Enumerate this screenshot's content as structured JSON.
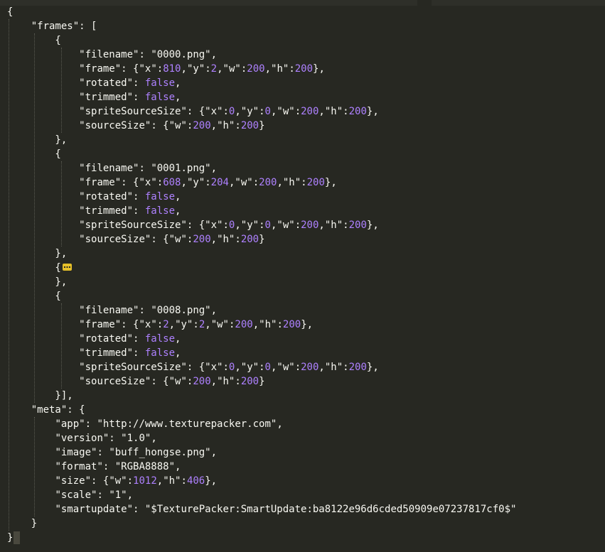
{
  "editor": {
    "lines": [
      [
        {
          "t": "p",
          "v": "{"
        }
      ],
      [
        {
          "t": "p",
          "v": "    "
        },
        {
          "t": "k",
          "v": "\"frames\""
        },
        {
          "t": "p",
          "v": ": ["
        }
      ],
      [
        {
          "t": "p",
          "v": "        {"
        }
      ],
      [
        {
          "t": "p",
          "v": "            "
        },
        {
          "t": "k",
          "v": "\"filename\""
        },
        {
          "t": "p",
          "v": ": "
        },
        {
          "t": "s",
          "v": "\"0000.png\""
        },
        {
          "t": "p",
          "v": ","
        }
      ],
      [
        {
          "t": "p",
          "v": "            "
        },
        {
          "t": "k",
          "v": "\"frame\""
        },
        {
          "t": "p",
          "v": ": {"
        },
        {
          "t": "k",
          "v": "\"x\""
        },
        {
          "t": "p",
          "v": ":"
        },
        {
          "t": "n",
          "v": "810"
        },
        {
          "t": "p",
          "v": ","
        },
        {
          "t": "k",
          "v": "\"y\""
        },
        {
          "t": "p",
          "v": ":"
        },
        {
          "t": "n",
          "v": "2"
        },
        {
          "t": "p",
          "v": ","
        },
        {
          "t": "k",
          "v": "\"w\""
        },
        {
          "t": "p",
          "v": ":"
        },
        {
          "t": "n",
          "v": "200"
        },
        {
          "t": "p",
          "v": ","
        },
        {
          "t": "k",
          "v": "\"h\""
        },
        {
          "t": "p",
          "v": ":"
        },
        {
          "t": "n",
          "v": "200"
        },
        {
          "t": "p",
          "v": "},"
        }
      ],
      [
        {
          "t": "p",
          "v": "            "
        },
        {
          "t": "k",
          "v": "\"rotated\""
        },
        {
          "t": "p",
          "v": ": "
        },
        {
          "t": "b",
          "v": "false"
        },
        {
          "t": "p",
          "v": ","
        }
      ],
      [
        {
          "t": "p",
          "v": "            "
        },
        {
          "t": "k",
          "v": "\"trimmed\""
        },
        {
          "t": "p",
          "v": ": "
        },
        {
          "t": "b",
          "v": "false"
        },
        {
          "t": "p",
          "v": ","
        }
      ],
      [
        {
          "t": "p",
          "v": "            "
        },
        {
          "t": "k",
          "v": "\"spriteSourceSize\""
        },
        {
          "t": "p",
          "v": ": {"
        },
        {
          "t": "k",
          "v": "\"x\""
        },
        {
          "t": "p",
          "v": ":"
        },
        {
          "t": "n",
          "v": "0"
        },
        {
          "t": "p",
          "v": ","
        },
        {
          "t": "k",
          "v": "\"y\""
        },
        {
          "t": "p",
          "v": ":"
        },
        {
          "t": "n",
          "v": "0"
        },
        {
          "t": "p",
          "v": ","
        },
        {
          "t": "k",
          "v": "\"w\""
        },
        {
          "t": "p",
          "v": ":"
        },
        {
          "t": "n",
          "v": "200"
        },
        {
          "t": "p",
          "v": ","
        },
        {
          "t": "k",
          "v": "\"h\""
        },
        {
          "t": "p",
          "v": ":"
        },
        {
          "t": "n",
          "v": "200"
        },
        {
          "t": "p",
          "v": "},"
        }
      ],
      [
        {
          "t": "p",
          "v": "            "
        },
        {
          "t": "k",
          "v": "\"sourceSize\""
        },
        {
          "t": "p",
          "v": ": {"
        },
        {
          "t": "k",
          "v": "\"w\""
        },
        {
          "t": "p",
          "v": ":"
        },
        {
          "t": "n",
          "v": "200"
        },
        {
          "t": "p",
          "v": ","
        },
        {
          "t": "k",
          "v": "\"h\""
        },
        {
          "t": "p",
          "v": ":"
        },
        {
          "t": "n",
          "v": "200"
        },
        {
          "t": "p",
          "v": "}"
        }
      ],
      [
        {
          "t": "p",
          "v": "        },"
        }
      ],
      [
        {
          "t": "p",
          "v": "        {"
        }
      ],
      [
        {
          "t": "p",
          "v": "            "
        },
        {
          "t": "k",
          "v": "\"filename\""
        },
        {
          "t": "p",
          "v": ": "
        },
        {
          "t": "s",
          "v": "\"0001.png\""
        },
        {
          "t": "p",
          "v": ","
        }
      ],
      [
        {
          "t": "p",
          "v": "            "
        },
        {
          "t": "k",
          "v": "\"frame\""
        },
        {
          "t": "p",
          "v": ": {"
        },
        {
          "t": "k",
          "v": "\"x\""
        },
        {
          "t": "p",
          "v": ":"
        },
        {
          "t": "n",
          "v": "608"
        },
        {
          "t": "p",
          "v": ","
        },
        {
          "t": "k",
          "v": "\"y\""
        },
        {
          "t": "p",
          "v": ":"
        },
        {
          "t": "n",
          "v": "204"
        },
        {
          "t": "p",
          "v": ","
        },
        {
          "t": "k",
          "v": "\"w\""
        },
        {
          "t": "p",
          "v": ":"
        },
        {
          "t": "n",
          "v": "200"
        },
        {
          "t": "p",
          "v": ","
        },
        {
          "t": "k",
          "v": "\"h\""
        },
        {
          "t": "p",
          "v": ":"
        },
        {
          "t": "n",
          "v": "200"
        },
        {
          "t": "p",
          "v": "},"
        }
      ],
      [
        {
          "t": "p",
          "v": "            "
        },
        {
          "t": "k",
          "v": "\"rotated\""
        },
        {
          "t": "p",
          "v": ": "
        },
        {
          "t": "b",
          "v": "false"
        },
        {
          "t": "p",
          "v": ","
        }
      ],
      [
        {
          "t": "p",
          "v": "            "
        },
        {
          "t": "k",
          "v": "\"trimmed\""
        },
        {
          "t": "p",
          "v": ": "
        },
        {
          "t": "b",
          "v": "false"
        },
        {
          "t": "p",
          "v": ","
        }
      ],
      [
        {
          "t": "p",
          "v": "            "
        },
        {
          "t": "k",
          "v": "\"spriteSourceSize\""
        },
        {
          "t": "p",
          "v": ": {"
        },
        {
          "t": "k",
          "v": "\"x\""
        },
        {
          "t": "p",
          "v": ":"
        },
        {
          "t": "n",
          "v": "0"
        },
        {
          "t": "p",
          "v": ","
        },
        {
          "t": "k",
          "v": "\"y\""
        },
        {
          "t": "p",
          "v": ":"
        },
        {
          "t": "n",
          "v": "0"
        },
        {
          "t": "p",
          "v": ","
        },
        {
          "t": "k",
          "v": "\"w\""
        },
        {
          "t": "p",
          "v": ":"
        },
        {
          "t": "n",
          "v": "200"
        },
        {
          "t": "p",
          "v": ","
        },
        {
          "t": "k",
          "v": "\"h\""
        },
        {
          "t": "p",
          "v": ":"
        },
        {
          "t": "n",
          "v": "200"
        },
        {
          "t": "p",
          "v": "},"
        }
      ],
      [
        {
          "t": "p",
          "v": "            "
        },
        {
          "t": "k",
          "v": "\"sourceSize\""
        },
        {
          "t": "p",
          "v": ": {"
        },
        {
          "t": "k",
          "v": "\"w\""
        },
        {
          "t": "p",
          "v": ":"
        },
        {
          "t": "n",
          "v": "200"
        },
        {
          "t": "p",
          "v": ","
        },
        {
          "t": "k",
          "v": "\"h\""
        },
        {
          "t": "p",
          "v": ":"
        },
        {
          "t": "n",
          "v": "200"
        },
        {
          "t": "p",
          "v": "}"
        }
      ],
      [
        {
          "t": "p",
          "v": "        },"
        }
      ],
      [
        {
          "t": "p",
          "v": "        {"
        },
        {
          "t": "fold",
          "v": ""
        }
      ],
      [
        {
          "t": "p",
          "v": "        },"
        }
      ],
      [
        {
          "t": "p",
          "v": "        {"
        }
      ],
      [
        {
          "t": "p",
          "v": "            "
        },
        {
          "t": "k",
          "v": "\"filename\""
        },
        {
          "t": "p",
          "v": ": "
        },
        {
          "t": "s",
          "v": "\"0008.png\""
        },
        {
          "t": "p",
          "v": ","
        }
      ],
      [
        {
          "t": "p",
          "v": "            "
        },
        {
          "t": "k",
          "v": "\"frame\""
        },
        {
          "t": "p",
          "v": ": {"
        },
        {
          "t": "k",
          "v": "\"x\""
        },
        {
          "t": "p",
          "v": ":"
        },
        {
          "t": "n",
          "v": "2"
        },
        {
          "t": "p",
          "v": ","
        },
        {
          "t": "k",
          "v": "\"y\""
        },
        {
          "t": "p",
          "v": ":"
        },
        {
          "t": "n",
          "v": "2"
        },
        {
          "t": "p",
          "v": ","
        },
        {
          "t": "k",
          "v": "\"w\""
        },
        {
          "t": "p",
          "v": ":"
        },
        {
          "t": "n",
          "v": "200"
        },
        {
          "t": "p",
          "v": ","
        },
        {
          "t": "k",
          "v": "\"h\""
        },
        {
          "t": "p",
          "v": ":"
        },
        {
          "t": "n",
          "v": "200"
        },
        {
          "t": "p",
          "v": "},"
        }
      ],
      [
        {
          "t": "p",
          "v": "            "
        },
        {
          "t": "k",
          "v": "\"rotated\""
        },
        {
          "t": "p",
          "v": ": "
        },
        {
          "t": "b",
          "v": "false"
        },
        {
          "t": "p",
          "v": ","
        }
      ],
      [
        {
          "t": "p",
          "v": "            "
        },
        {
          "t": "k",
          "v": "\"trimmed\""
        },
        {
          "t": "p",
          "v": ": "
        },
        {
          "t": "b",
          "v": "false"
        },
        {
          "t": "p",
          "v": ","
        }
      ],
      [
        {
          "t": "p",
          "v": "            "
        },
        {
          "t": "k",
          "v": "\"spriteSourceSize\""
        },
        {
          "t": "p",
          "v": ": {"
        },
        {
          "t": "k",
          "v": "\"x\""
        },
        {
          "t": "p",
          "v": ":"
        },
        {
          "t": "n",
          "v": "0"
        },
        {
          "t": "p",
          "v": ","
        },
        {
          "t": "k",
          "v": "\"y\""
        },
        {
          "t": "p",
          "v": ":"
        },
        {
          "t": "n",
          "v": "0"
        },
        {
          "t": "p",
          "v": ","
        },
        {
          "t": "k",
          "v": "\"w\""
        },
        {
          "t": "p",
          "v": ":"
        },
        {
          "t": "n",
          "v": "200"
        },
        {
          "t": "p",
          "v": ","
        },
        {
          "t": "k",
          "v": "\"h\""
        },
        {
          "t": "p",
          "v": ":"
        },
        {
          "t": "n",
          "v": "200"
        },
        {
          "t": "p",
          "v": "},"
        }
      ],
      [
        {
          "t": "p",
          "v": "            "
        },
        {
          "t": "k",
          "v": "\"sourceSize\""
        },
        {
          "t": "p",
          "v": ": {"
        },
        {
          "t": "k",
          "v": "\"w\""
        },
        {
          "t": "p",
          "v": ":"
        },
        {
          "t": "n",
          "v": "200"
        },
        {
          "t": "p",
          "v": ","
        },
        {
          "t": "k",
          "v": "\"h\""
        },
        {
          "t": "p",
          "v": ":"
        },
        {
          "t": "n",
          "v": "200"
        },
        {
          "t": "p",
          "v": "}"
        }
      ],
      [
        {
          "t": "p",
          "v": "        }],"
        }
      ],
      [
        {
          "t": "p",
          "v": "    "
        },
        {
          "t": "k",
          "v": "\"meta\""
        },
        {
          "t": "p",
          "v": ": {"
        }
      ],
      [
        {
          "t": "p",
          "v": "        "
        },
        {
          "t": "k",
          "v": "\"app\""
        },
        {
          "t": "p",
          "v": ": "
        },
        {
          "t": "s",
          "v": "\"http://www.texturepacker.com\""
        },
        {
          "t": "p",
          "v": ","
        }
      ],
      [
        {
          "t": "p",
          "v": "        "
        },
        {
          "t": "k",
          "v": "\"version\""
        },
        {
          "t": "p",
          "v": ": "
        },
        {
          "t": "s",
          "v": "\"1.0\""
        },
        {
          "t": "p",
          "v": ","
        }
      ],
      [
        {
          "t": "p",
          "v": "        "
        },
        {
          "t": "k",
          "v": "\"image\""
        },
        {
          "t": "p",
          "v": ": "
        },
        {
          "t": "s",
          "v": "\"buff_hongse.png\""
        },
        {
          "t": "p",
          "v": ","
        }
      ],
      [
        {
          "t": "p",
          "v": "        "
        },
        {
          "t": "k",
          "v": "\"format\""
        },
        {
          "t": "p",
          "v": ": "
        },
        {
          "t": "s",
          "v": "\"RGBA8888\""
        },
        {
          "t": "p",
          "v": ","
        }
      ],
      [
        {
          "t": "p",
          "v": "        "
        },
        {
          "t": "k",
          "v": "\"size\""
        },
        {
          "t": "p",
          "v": ": {"
        },
        {
          "t": "k",
          "v": "\"w\""
        },
        {
          "t": "p",
          "v": ":"
        },
        {
          "t": "n",
          "v": "1012"
        },
        {
          "t": "p",
          "v": ","
        },
        {
          "t": "k",
          "v": "\"h\""
        },
        {
          "t": "p",
          "v": ":"
        },
        {
          "t": "n",
          "v": "406"
        },
        {
          "t": "p",
          "v": "},"
        }
      ],
      [
        {
          "t": "p",
          "v": "        "
        },
        {
          "t": "k",
          "v": "\"scale\""
        },
        {
          "t": "p",
          "v": ": "
        },
        {
          "t": "s",
          "v": "\"1\""
        },
        {
          "t": "p",
          "v": ","
        }
      ],
      [
        {
          "t": "p",
          "v": "        "
        },
        {
          "t": "k",
          "v": "\"smartupdate\""
        },
        {
          "t": "p",
          "v": ": "
        },
        {
          "t": "s",
          "v": "\"$TexturePacker:SmartUpdate:ba8122e96d6cded50909e07237817cf0$\""
        }
      ],
      [
        {
          "t": "p",
          "v": "    }"
        }
      ],
      [
        {
          "t": "p",
          "v": "}"
        },
        {
          "t": "cursor",
          "v": ""
        }
      ]
    ]
  },
  "colors": {
    "background": "#272822",
    "text": "#f8f8f2",
    "number": "#ae81ff",
    "boolean": "#ae81ff",
    "fold_marker": "#e6c029",
    "guide": "#5a5b52"
  }
}
